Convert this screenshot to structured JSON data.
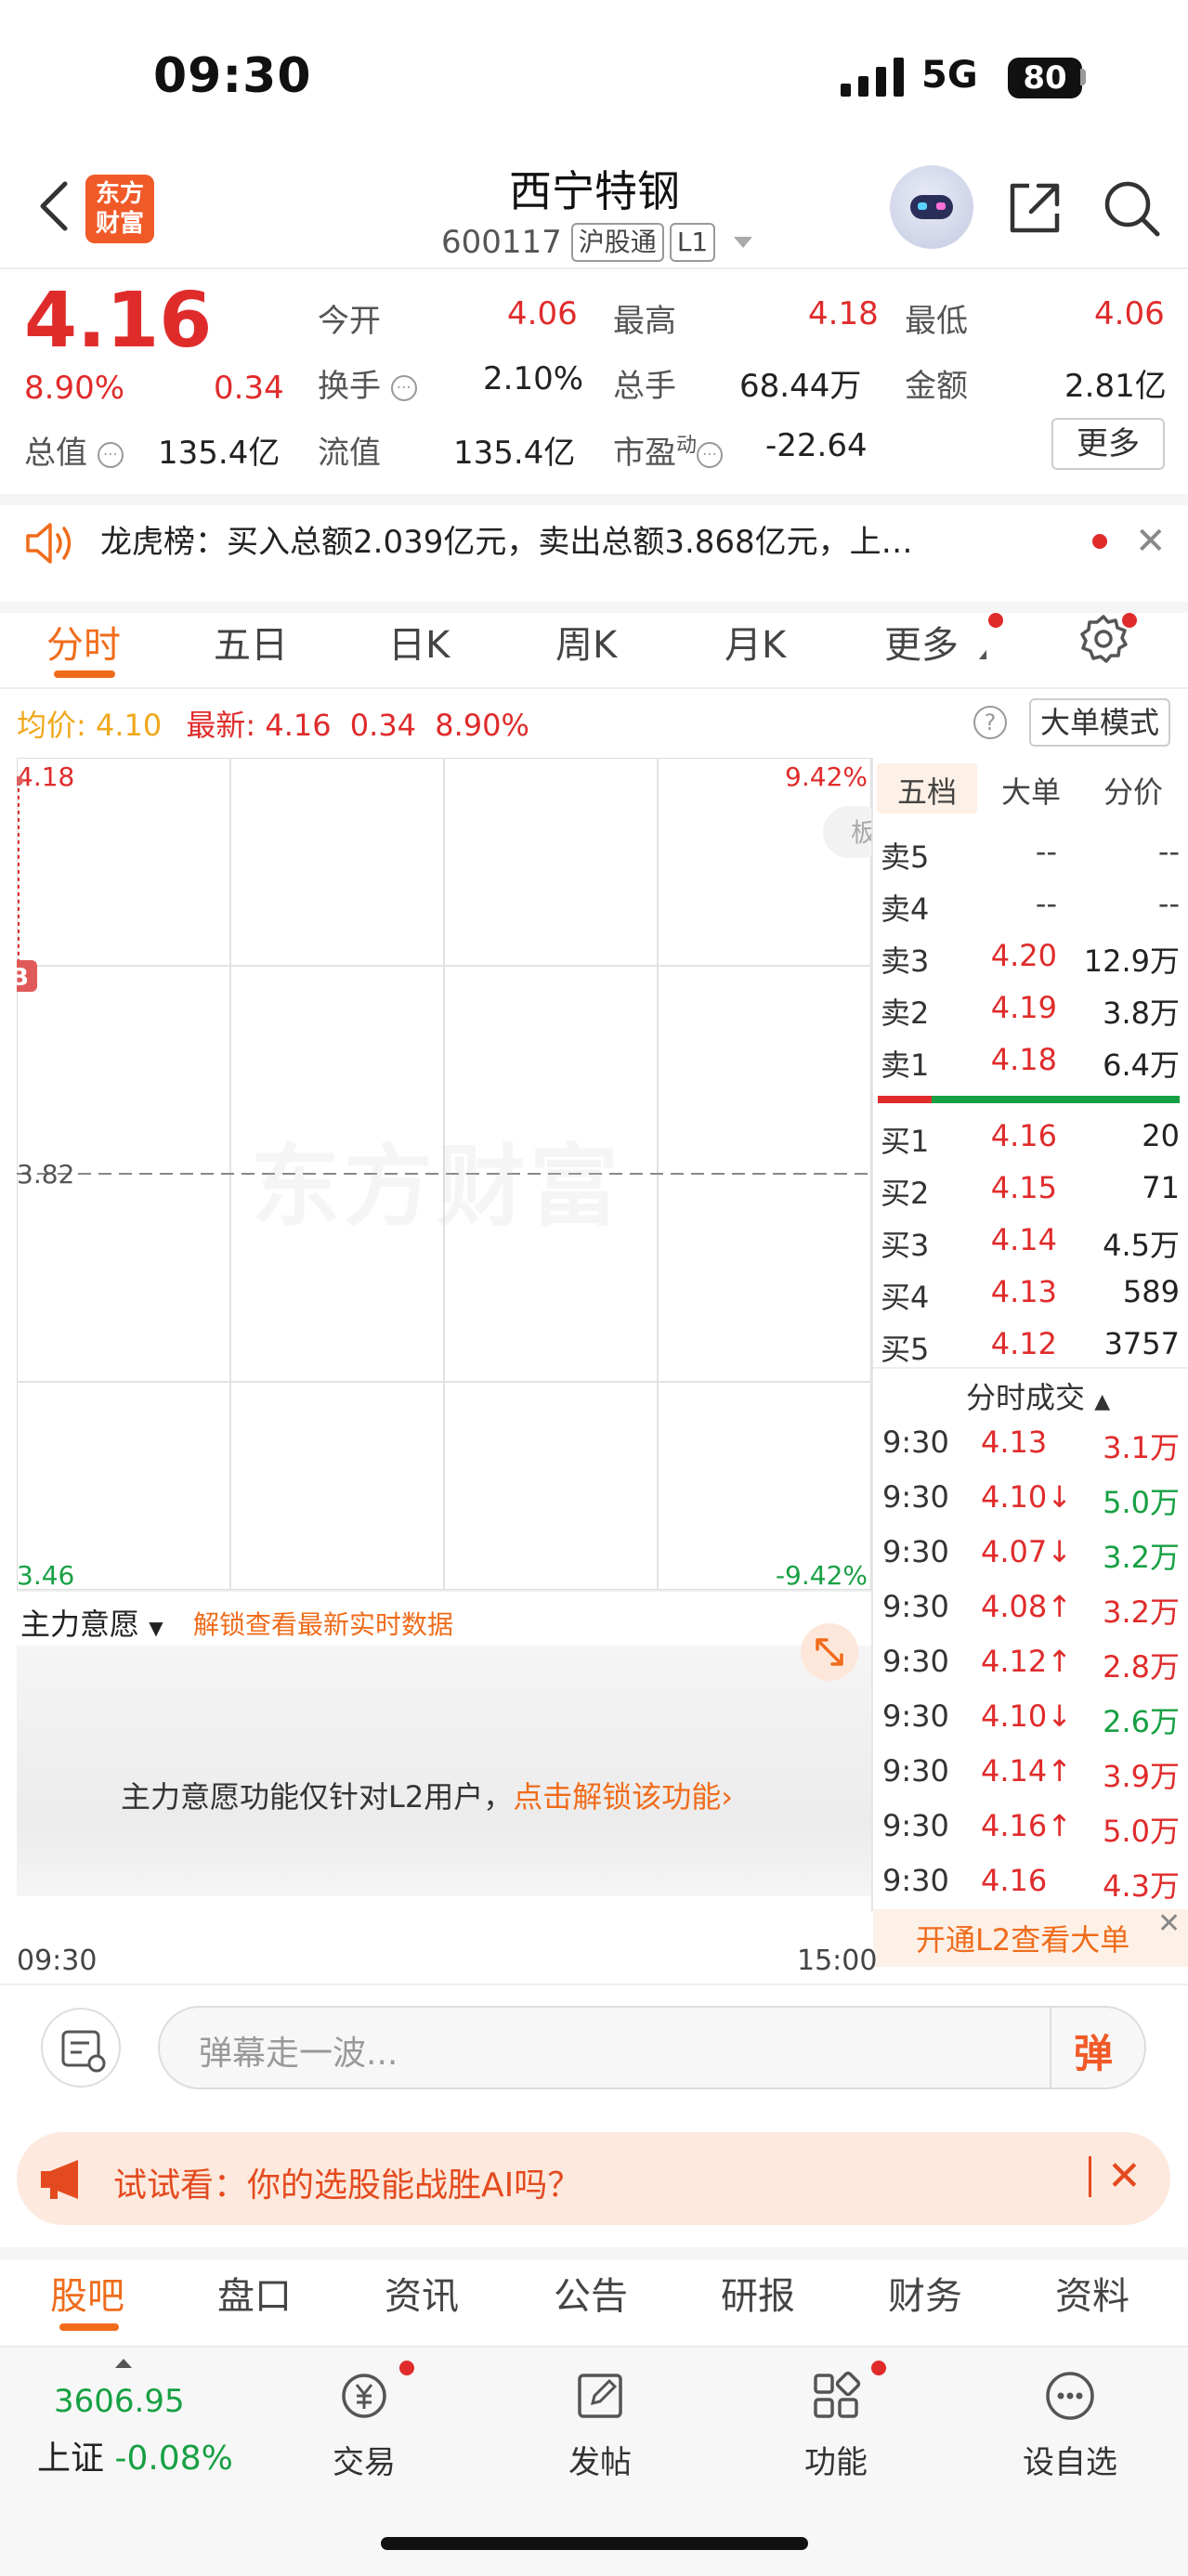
{
  "status": {
    "time": "09:30",
    "network": "5G",
    "battery": "80"
  },
  "header": {
    "logo_line1": "东方",
    "logo_line2": "财富",
    "stock_name": "西宁特钢",
    "stock_code": "600117",
    "tag_connect": "沪股通",
    "tag_level": "L1"
  },
  "quote": {
    "price": "4.16",
    "change_pct": "8.90%",
    "change_amt": "0.34",
    "open_label": "今开",
    "open": "4.06",
    "high_label": "最高",
    "high": "4.18",
    "low_label": "最低",
    "low": "4.06",
    "turnover_label": "换手",
    "turnover": "2.10%",
    "volume_label": "总手",
    "volume": "68.44万",
    "amount_label": "金额",
    "amount": "2.81亿",
    "mktcap_label": "总值",
    "mktcap": "135.4亿",
    "float_label": "流值",
    "float_cap": "135.4亿",
    "pe_label": "市盈",
    "pe_sup": "动",
    "pe": "-22.64",
    "more": "更多"
  },
  "notice": {
    "text": "龙虎榜：买入总额2.039亿元，卖出总额3.868亿元，上…"
  },
  "tabs": [
    "分时",
    "五日",
    "日K",
    "周K",
    "月K",
    "更多"
  ],
  "chart_header": {
    "avg_label": "均价:",
    "avg": "4.10",
    "latest_label": "最新:",
    "latest": "4.16",
    "latest_chg": "0.34",
    "latest_pct": "8.90%",
    "big_mode": "大单模式"
  },
  "chart_data": {
    "type": "line",
    "x": [
      "09:30"
    ],
    "y": [
      4.16
    ],
    "ylim": [
      3.46,
      4.18
    ],
    "y_ticks": [
      "4.18",
      "3.82",
      "3.46"
    ],
    "right_ticks": [
      "9.42%",
      "-9.42%"
    ],
    "x_ticks": [
      "09:30",
      "15:00"
    ],
    "baseline": 3.82,
    "marker": "B"
  },
  "watermark": "东方财富",
  "orderbook": {
    "tabs": [
      "五档",
      "大单",
      "分价"
    ],
    "asks": [
      {
        "label": "卖5",
        "price": "--",
        "vol": "--"
      },
      {
        "label": "卖4",
        "price": "--",
        "vol": "--"
      },
      {
        "label": "卖3",
        "price": "4.20",
        "vol": "12.9万"
      },
      {
        "label": "卖2",
        "price": "4.19",
        "vol": "3.8万"
      },
      {
        "label": "卖1",
        "price": "4.18",
        "vol": "6.4万"
      }
    ],
    "bids": [
      {
        "label": "买1",
        "price": "4.16",
        "vol": "20"
      },
      {
        "label": "买2",
        "price": "4.15",
        "vol": "71"
      },
      {
        "label": "买3",
        "price": "4.14",
        "vol": "4.5万"
      },
      {
        "label": "买4",
        "price": "4.13",
        "vol": "589"
      },
      {
        "label": "买5",
        "price": "4.12",
        "vol": "3757"
      }
    ]
  },
  "trades": {
    "title": "分时成交",
    "rows": [
      {
        "t": "9:30",
        "p": "4.13",
        "arrow": "",
        "v": "3.1万",
        "dir": "red"
      },
      {
        "t": "9:30",
        "p": "4.10",
        "arrow": "↓",
        "v": "5.0万",
        "dir": "green"
      },
      {
        "t": "9:30",
        "p": "4.07",
        "arrow": "↓",
        "v": "3.2万",
        "dir": "green"
      },
      {
        "t": "9:30",
        "p": "4.08",
        "arrow": "↑",
        "v": "3.2万",
        "dir": "red"
      },
      {
        "t": "9:30",
        "p": "4.12",
        "arrow": "↑",
        "v": "2.8万",
        "dir": "red"
      },
      {
        "t": "9:30",
        "p": "4.10",
        "arrow": "↓",
        "v": "2.6万",
        "dir": "green"
      },
      {
        "t": "9:30",
        "p": "4.14",
        "arrow": "↑",
        "v": "3.9万",
        "dir": "red"
      },
      {
        "t": "9:30",
        "p": "4.16",
        "arrow": "↑",
        "v": "5.0万",
        "dir": "red"
      },
      {
        "t": "9:30",
        "p": "4.16",
        "arrow": "",
        "v": "4.3万",
        "dir": "red"
      }
    ],
    "l2_promo": "开通L2查看大单"
  },
  "mainforce": {
    "label": "主力意愿",
    "lock_text": "解锁查看最新实时数据",
    "msg": "主力意愿功能仅针对L2用户，",
    "msg_link": "点击解锁该功能"
  },
  "danmaku": {
    "placeholder": "弹幕走一波...",
    "send": "弹"
  },
  "ai_banner": {
    "text": "试试看：你的选股能战胜AI吗？"
  },
  "bottom_tabs": [
    "股吧",
    "盘口",
    "资讯",
    "公告",
    "研报",
    "财务",
    "资料"
  ],
  "bottom_nav": {
    "index_value": "3606.95",
    "index_name": "上证",
    "index_change": "-0.08%",
    "items": [
      "交易",
      "发帖",
      "功能",
      "设自选"
    ]
  }
}
